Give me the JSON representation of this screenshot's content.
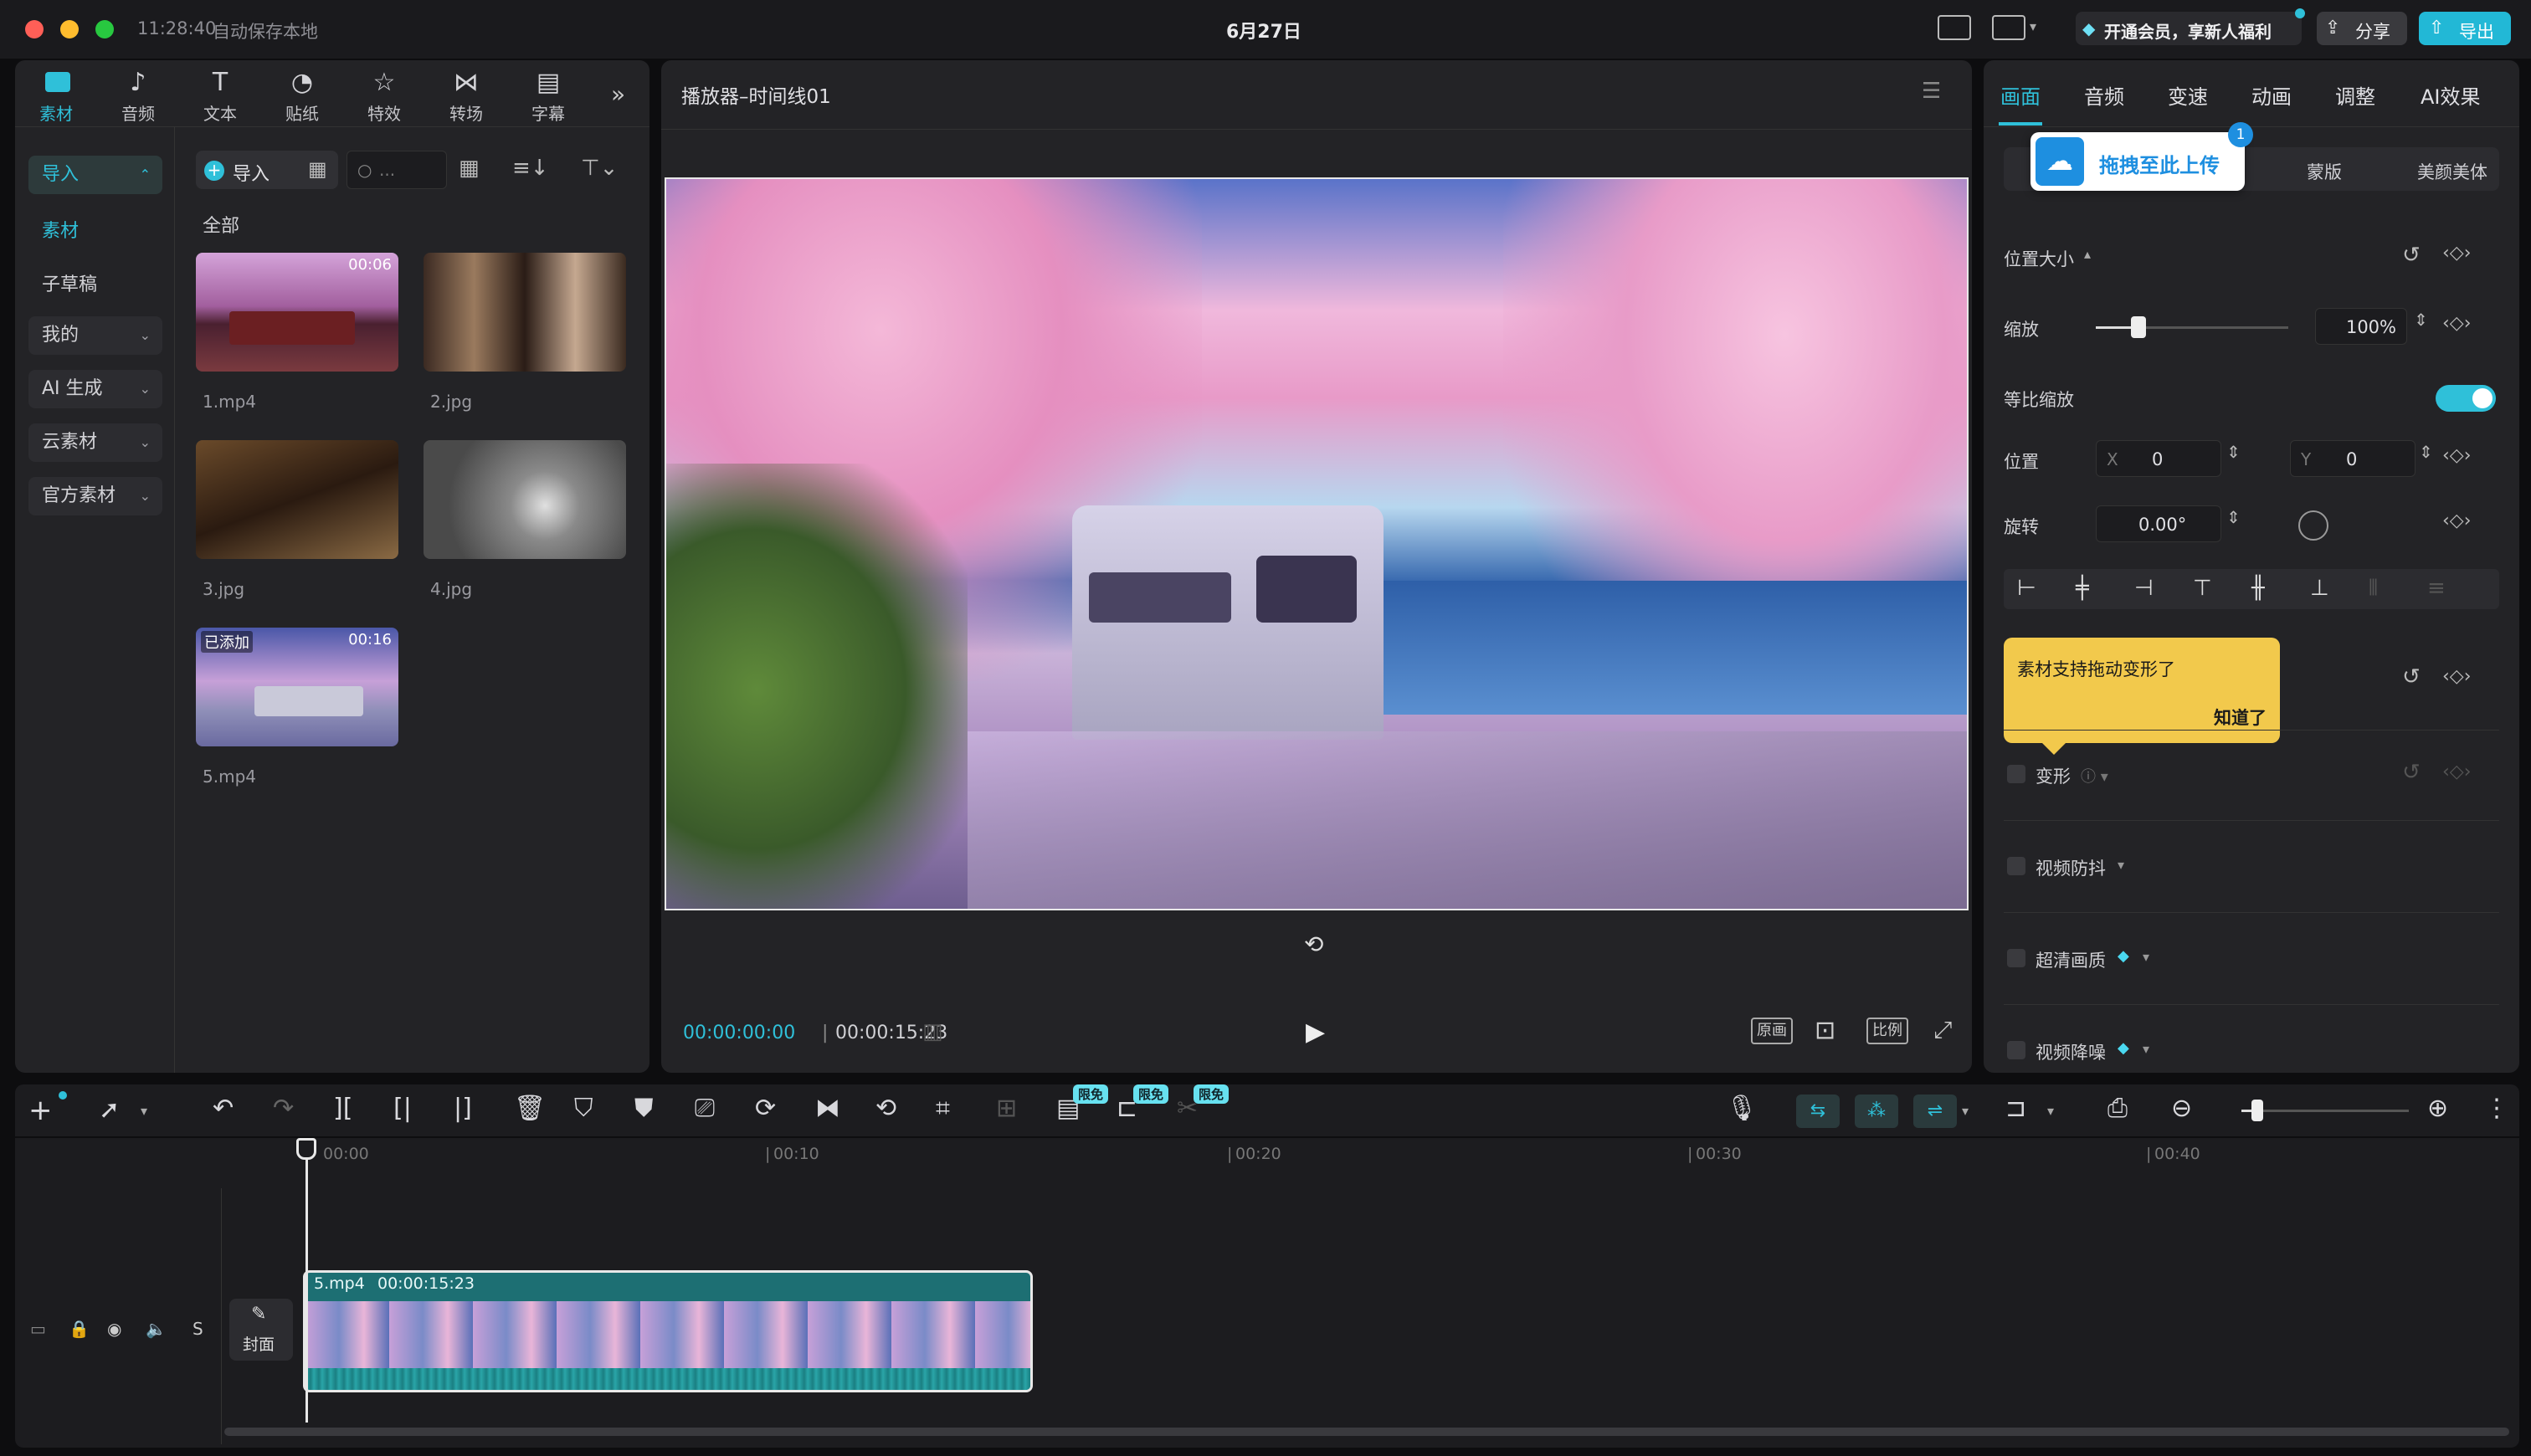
{
  "title_bar": {
    "time": "11:28:40",
    "autosave": "自动保存本地",
    "date": "6月27日",
    "member": "开通会员，享新人福利",
    "share": "分享",
    "export": "导出"
  },
  "media_tabs": [
    {
      "label": "素材",
      "icon": "media-icon"
    },
    {
      "label": "音频",
      "icon": "audio-icon"
    },
    {
      "label": "文本",
      "icon": "text-icon"
    },
    {
      "label": "贴纸",
      "icon": "sticker-icon"
    },
    {
      "label": "特效",
      "icon": "effects-icon"
    },
    {
      "label": "转场",
      "icon": "transition-icon"
    },
    {
      "label": "字幕",
      "icon": "subtitle-icon"
    }
  ],
  "sidebar": {
    "import": "导入",
    "material": "素材",
    "draft": "子草稿",
    "mine": "我的",
    "ai": "AI 生成",
    "cloud": "云素材",
    "official": "官方素材"
  },
  "library": {
    "import_btn": "导入",
    "search_placeholder": "...",
    "all_label": "全部",
    "items": [
      {
        "name": "1.mp4",
        "duration": "00:06"
      },
      {
        "name": "2.jpg"
      },
      {
        "name": "3.jpg"
      },
      {
        "name": "4.jpg"
      },
      {
        "name": "5.mp4",
        "added": "已添加",
        "duration": "00:16"
      }
    ]
  },
  "player": {
    "title": "播放器–时间线01",
    "current_time": "00:00:00:00",
    "total_time": "00:00:15:23",
    "btn_original": "原画",
    "btn_ratio": "比例"
  },
  "inspector": {
    "tabs": [
      "画面",
      "音频",
      "变速",
      "动画",
      "调整",
      "AI效果"
    ],
    "subtabs": {
      "upload": "拖拽至此上传",
      "upload_count": "1",
      "mask": "蒙版",
      "beauty": "美颜美体"
    },
    "position_size": "位置大小",
    "scale": "缩放",
    "scale_value": "100%",
    "uniform_scale": "等比缩放",
    "uniform_scale_on": true,
    "position": "位置",
    "x_label": "X",
    "x_value": "0",
    "y_label": "Y",
    "y_value": "0",
    "rotation": "旋转",
    "rotation_value": "0.00°",
    "tooltip_text": "素材支持拖动变形了",
    "tooltip_ok": "知道了",
    "transform": "变形",
    "stabilize": "视频防抖",
    "hd": "超清画质",
    "denoise": "视频降噪"
  },
  "toolbar": {
    "limited": "限免"
  },
  "timeline": {
    "ticks": [
      "00:00",
      "00:10",
      "00:20",
      "00:30",
      "00:40"
    ],
    "cover": "封面",
    "clip_name": "5.mp4",
    "clip_duration": "00:00:15:23"
  },
  "colors": {
    "accent": "#2fc0d9",
    "clip": "#1d6f73",
    "tooltip": "#f2c94c"
  }
}
